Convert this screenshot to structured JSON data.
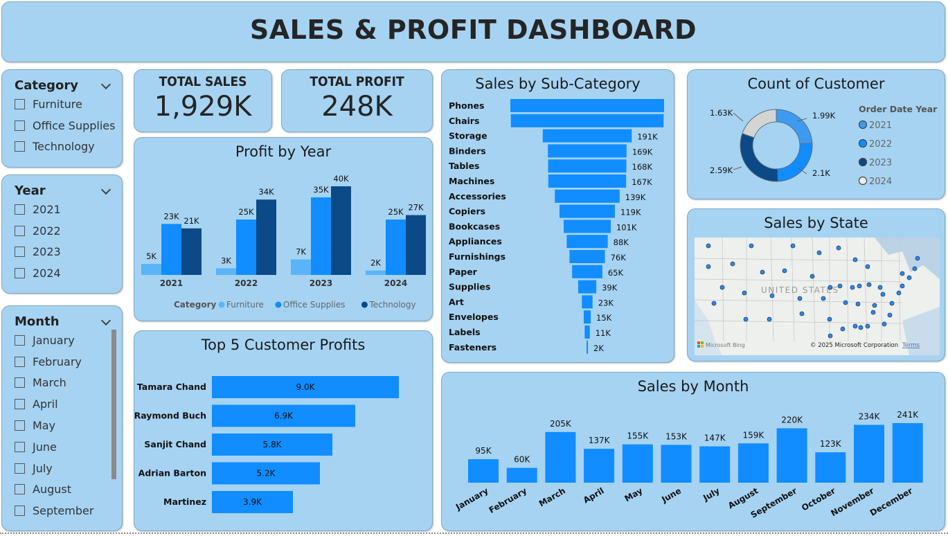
{
  "header": {
    "title": "SALES & PROFIT DASHBOARD"
  },
  "slicers": {
    "category": {
      "title": "Category",
      "options": [
        "Furniture",
        "Office Supplies",
        "Technology"
      ]
    },
    "year": {
      "title": "Year",
      "options": [
        "2021",
        "2022",
        "2023",
        "2024"
      ]
    },
    "month": {
      "title": "Month",
      "options": [
        "January",
        "February",
        "March",
        "April",
        "May",
        "June",
        "July",
        "August",
        "September"
      ]
    }
  },
  "kpis": {
    "total_sales": {
      "label": "TOTAL SALES",
      "value": "1,929K"
    },
    "total_profit": {
      "label": "TOTAL PROFIT",
      "value": "248K"
    }
  },
  "colors": {
    "furniture": "#5ab4f7",
    "office": "#118dff",
    "technology": "#0b4a86",
    "panel": "#a6d3f2",
    "bar": "#118dff",
    "donut_2024": "#d4d4d4"
  },
  "chart_data": [
    {
      "id": "profit_by_year",
      "type": "bar",
      "title": "Profit by Year",
      "categories": [
        "2021",
        "2022",
        "2023",
        "2024"
      ],
      "legend_title": "Category",
      "series": [
        {
          "name": "Furniture",
          "values": [
            5,
            3,
            7,
            2
          ],
          "labels": [
            "5K",
            "3K",
            "7K",
            "2K"
          ]
        },
        {
          "name": "Office Supplies",
          "values": [
            23,
            25,
            35,
            25
          ],
          "labels": [
            "23K",
            "25K",
            "35K",
            "25K"
          ]
        },
        {
          "name": "Technology",
          "values": [
            21,
            34,
            40,
            27
          ],
          "labels": [
            "21K",
            "34K",
            "40K",
            "27K"
          ]
        }
      ]
    },
    {
      "id": "sales_by_subcategory",
      "type": "bar",
      "title": "Sales by Sub-Category",
      "categories": [
        "Phones",
        "Chairs",
        "Storage",
        "Binders",
        "Tables",
        "Machines",
        "Accessories",
        "Copiers",
        "Bookcases",
        "Appliances",
        "Furnishings",
        "Paper",
        "Supplies",
        "Art",
        "Envelopes",
        "Labels",
        "Fasteners"
      ],
      "values": [
        330,
        328,
        191,
        169,
        168,
        167,
        139,
        119,
        101,
        88,
        76,
        65,
        39,
        23,
        15,
        11,
        2
      ],
      "labels": [
        "",
        "",
        "191K",
        "169K",
        "168K",
        "167K",
        "139K",
        "119K",
        "101K",
        "88K",
        "76K",
        "65K",
        "39K",
        "23K",
        "15K",
        "11K",
        "2K"
      ]
    },
    {
      "id": "count_of_customer",
      "type": "pie",
      "title": "Count of Customer",
      "legend_title": "Order Date Year",
      "categories": [
        "2021",
        "2022",
        "2023",
        "2024"
      ],
      "values": [
        1.99,
        2.1,
        2.59,
        1.63
      ],
      "labels": [
        "1.99K",
        "2.1K",
        "2.59K",
        "1.63K"
      ]
    },
    {
      "id": "top5_customer_profits",
      "type": "bar",
      "title": "Top 5 Customer Profits",
      "categories": [
        "Tamara Chand",
        "Raymond Buch",
        "Sanjit Chand",
        "Adrian Barton",
        "Martinez"
      ],
      "values": [
        9.0,
        6.9,
        5.8,
        5.2,
        3.9
      ],
      "labels": [
        "9.0K",
        "6.9K",
        "5.8K",
        "5.2K",
        "3.9K"
      ]
    },
    {
      "id": "sales_by_month",
      "type": "bar",
      "title": "Sales by Month",
      "categories": [
        "January",
        "February",
        "March",
        "April",
        "May",
        "June",
        "July",
        "August",
        "September",
        "October",
        "November",
        "December"
      ],
      "values": [
        95,
        60,
        205,
        137,
        155,
        153,
        147,
        159,
        220,
        123,
        234,
        241
      ],
      "labels": [
        "95K",
        "60K",
        "205K",
        "137K",
        "155K",
        "153K",
        "147K",
        "159K",
        "220K",
        "123K",
        "234K",
        "241K"
      ]
    }
  ],
  "map": {
    "title": "Sales by State",
    "country_label": "UNITED STATES",
    "attribution": "Microsoft Bing",
    "copyright": "© 2025 Microsoft Corporation",
    "terms": "Terms"
  }
}
